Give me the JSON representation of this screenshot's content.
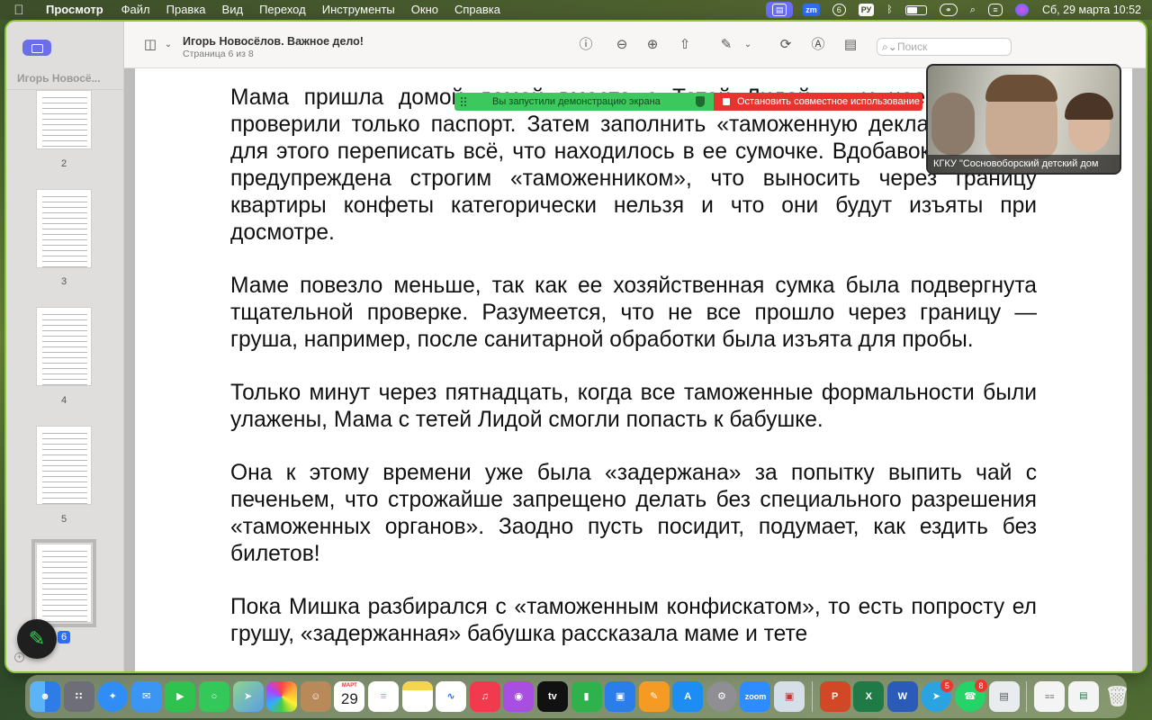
{
  "menubar": {
    "app_name": "Просмотр",
    "items": [
      "Файл",
      "Правка",
      "Вид",
      "Переход",
      "Инструменты",
      "Окно",
      "Справка"
    ],
    "status": {
      "zoom_label": "zm",
      "notification_count": "6",
      "input_language": "РУ",
      "datetime": "Сб, 29 марта  10:52"
    }
  },
  "toolbar": {
    "document_title": "Игорь Новосёлов. Важное дело!",
    "page_indicator": "Страница 6 из 8",
    "search_placeholder": "Поиск"
  },
  "sidebar": {
    "doc_name": "Игорь Новосё...",
    "pages": [
      {
        "number": "2"
      },
      {
        "number": "3"
      },
      {
        "number": "4"
      },
      {
        "number": "5"
      },
      {
        "number": "6",
        "selected": true
      }
    ]
  },
  "share_bar": {
    "status_text": "Вы запустили демонстрацию экрана",
    "stop_label": "Остановить совместное использование"
  },
  "video_tile": {
    "caption": "КГКУ \"Сосновоборский детский дом"
  },
  "document": {
    "paragraphs": [
      "Мама пришла домой домой вместе с Тетей Лидой — у нее на посту проверили только паспорт. Затем заполнить «таможенную декларацию», а для этого переписать всё, что находилось в ее сумочке. Вдобавок она была предупреждена строгим «таможенником», что выносить через границу квартиры конфеты категорически нельзя и что они будут изъяты при досмотре.",
      "Маме повезло меньше, так как ее хозяйственная сумка была подвергнута тщательной проверке. Разумеется, что не все прошло через границу — груша, например, после санитарной обработки была изъята для пробы.",
      "Только минут через пятнадцать, когда все таможенные формальности были улажены, Мама с тетей Лидой смогли попасть к бабушке.",
      "Она к этому времени уже была «задержана» за попытку выпить чай с печеньем, что строжайше запрещено делать без специального разрешения «таможенных органов». Заодно пусть посидит, подумает, как ездить без билетов!",
      "Пока Мишка разбирался с «таможенным конфискатом», то есть попросту ел грушу, «задержанная» бабушка рассказала маме и тете"
    ]
  },
  "dock": {
    "calendar_month": "МАРТ",
    "calendar_day": "29",
    "zoom_label": "zoom",
    "appletv_label": "tv",
    "telegram_badge": "5",
    "whatsapp_badge": "8",
    "apps": [
      {
        "name": "finder",
        "color": "#3d8ef0"
      },
      {
        "name": "launchpad",
        "color": "#6e6e78"
      },
      {
        "name": "safari",
        "color": "#2f8df5"
      },
      {
        "name": "mail",
        "color": "#3b95f4"
      },
      {
        "name": "facetime",
        "color": "#2ec24e"
      },
      {
        "name": "messages",
        "color": "#34c759"
      },
      {
        "name": "maps",
        "color": "#5ab85e"
      },
      {
        "name": "photos",
        "color": "#f4f4f4"
      },
      {
        "name": "contacts",
        "color": "#b88a5a"
      },
      {
        "name": "calendar",
        "color": "#ffffff"
      },
      {
        "name": "reminders",
        "color": "#ffffff"
      },
      {
        "name": "notes",
        "color": "#f6d54a"
      },
      {
        "name": "freeform",
        "color": "#ffffff"
      },
      {
        "name": "music",
        "color": "#f23a4f"
      },
      {
        "name": "podcasts",
        "color": "#a84ee0"
      },
      {
        "name": "appletv",
        "color": "#111111"
      },
      {
        "name": "numbers",
        "color": "#2fb24c"
      },
      {
        "name": "keynote",
        "color": "#2b7de9"
      },
      {
        "name": "pages",
        "color": "#f59a23"
      },
      {
        "name": "appstore",
        "color": "#1c8df3"
      },
      {
        "name": "settings",
        "color": "#8e8e93"
      },
      {
        "name": "zoom",
        "color": "#2d8cff"
      },
      {
        "name": "preview",
        "color": "#d6dfe8"
      },
      {
        "name": "powerpoint",
        "color": "#d24726"
      },
      {
        "name": "excel",
        "color": "#1f7a45"
      },
      {
        "name": "word",
        "color": "#2b5bb8"
      },
      {
        "name": "telegram",
        "color": "#2aa3e0"
      },
      {
        "name": "whatsapp",
        "color": "#25d366"
      },
      {
        "name": "preview-doc",
        "color": "#e9ecef"
      }
    ]
  }
}
